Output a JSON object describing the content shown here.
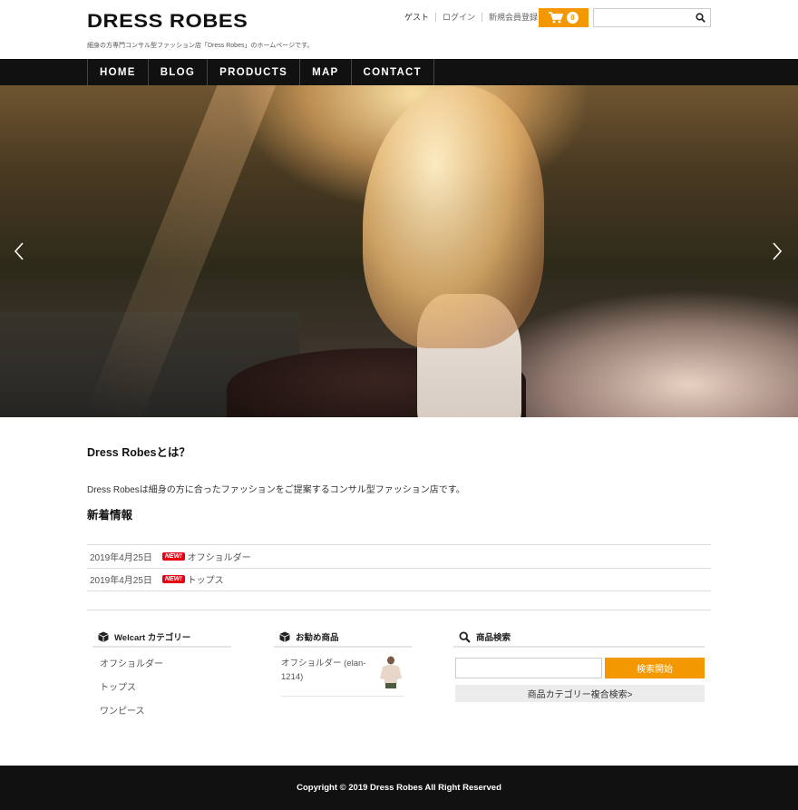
{
  "header": {
    "logo": "DRESS ROBES",
    "tagline": "細身の方専門コンサル型ファッション店「Dress Robes」のホームページです。",
    "guest_label": "ゲスト",
    "login_label": "ログイン",
    "register_label": "新規会員登録",
    "cart_count": "0",
    "search_placeholder": ""
  },
  "nav": {
    "items": [
      {
        "label": "HOME"
      },
      {
        "label": "BLOG"
      },
      {
        "label": "PRODUCTS"
      },
      {
        "label": "MAP"
      },
      {
        "label": "CONTACT"
      }
    ]
  },
  "main": {
    "about_title": "Dress Robesとは？",
    "about_text": "Dress Robesは細身の方に合ったファッションをご提案するコンサル型ファッション店です。",
    "news_title": "新着情報",
    "news": [
      {
        "date": "2019年4月25日",
        "badge": "NEW!",
        "title": "オフショルダー"
      },
      {
        "date": "2019年4月25日",
        "badge": "NEW!",
        "title": "トップス"
      }
    ]
  },
  "widgets": {
    "categories": {
      "title": "Welcart カテゴリー",
      "items": [
        "オフショルダー",
        "トップス",
        "ワンピース"
      ]
    },
    "recommended": {
      "title": "お勧め商品",
      "item_name": "オフショルダー (elan-1214)"
    },
    "item_search": {
      "title": "商品検索",
      "button_label": "検索開始",
      "advanced_label": "商品カテゴリー複合検索>"
    }
  },
  "footer": {
    "copyright": "Copyright © 2019 Dress Robes All Right Reserved"
  },
  "colors": {
    "accent": "#f39800",
    "nav_bg": "#111111",
    "new_badge": "#e60012"
  }
}
